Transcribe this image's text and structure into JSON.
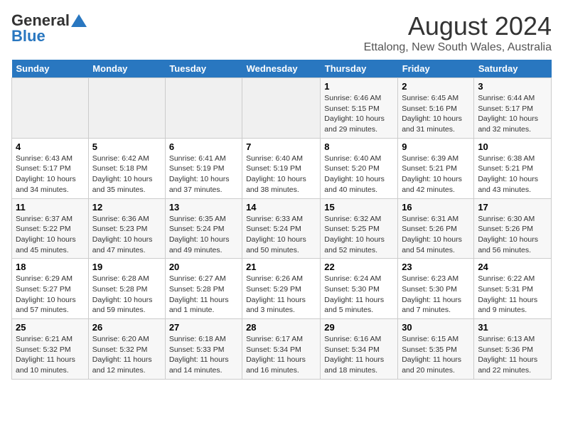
{
  "header": {
    "logo_general": "General",
    "logo_blue": "Blue",
    "month_year": "August 2024",
    "location": "Ettalong, New South Wales, Australia"
  },
  "weekdays": [
    "Sunday",
    "Monday",
    "Tuesday",
    "Wednesday",
    "Thursday",
    "Friday",
    "Saturday"
  ],
  "weeks": [
    [
      {
        "day": "",
        "info": ""
      },
      {
        "day": "",
        "info": ""
      },
      {
        "day": "",
        "info": ""
      },
      {
        "day": "",
        "info": ""
      },
      {
        "day": "1",
        "info": "Sunrise: 6:46 AM\nSunset: 5:15 PM\nDaylight: 10 hours\nand 29 minutes."
      },
      {
        "day": "2",
        "info": "Sunrise: 6:45 AM\nSunset: 5:16 PM\nDaylight: 10 hours\nand 31 minutes."
      },
      {
        "day": "3",
        "info": "Sunrise: 6:44 AM\nSunset: 5:17 PM\nDaylight: 10 hours\nand 32 minutes."
      }
    ],
    [
      {
        "day": "4",
        "info": "Sunrise: 6:43 AM\nSunset: 5:17 PM\nDaylight: 10 hours\nand 34 minutes."
      },
      {
        "day": "5",
        "info": "Sunrise: 6:42 AM\nSunset: 5:18 PM\nDaylight: 10 hours\nand 35 minutes."
      },
      {
        "day": "6",
        "info": "Sunrise: 6:41 AM\nSunset: 5:19 PM\nDaylight: 10 hours\nand 37 minutes."
      },
      {
        "day": "7",
        "info": "Sunrise: 6:40 AM\nSunset: 5:19 PM\nDaylight: 10 hours\nand 38 minutes."
      },
      {
        "day": "8",
        "info": "Sunrise: 6:40 AM\nSunset: 5:20 PM\nDaylight: 10 hours\nand 40 minutes."
      },
      {
        "day": "9",
        "info": "Sunrise: 6:39 AM\nSunset: 5:21 PM\nDaylight: 10 hours\nand 42 minutes."
      },
      {
        "day": "10",
        "info": "Sunrise: 6:38 AM\nSunset: 5:21 PM\nDaylight: 10 hours\nand 43 minutes."
      }
    ],
    [
      {
        "day": "11",
        "info": "Sunrise: 6:37 AM\nSunset: 5:22 PM\nDaylight: 10 hours\nand 45 minutes."
      },
      {
        "day": "12",
        "info": "Sunrise: 6:36 AM\nSunset: 5:23 PM\nDaylight: 10 hours\nand 47 minutes."
      },
      {
        "day": "13",
        "info": "Sunrise: 6:35 AM\nSunset: 5:24 PM\nDaylight: 10 hours\nand 49 minutes."
      },
      {
        "day": "14",
        "info": "Sunrise: 6:33 AM\nSunset: 5:24 PM\nDaylight: 10 hours\nand 50 minutes."
      },
      {
        "day": "15",
        "info": "Sunrise: 6:32 AM\nSunset: 5:25 PM\nDaylight: 10 hours\nand 52 minutes."
      },
      {
        "day": "16",
        "info": "Sunrise: 6:31 AM\nSunset: 5:26 PM\nDaylight: 10 hours\nand 54 minutes."
      },
      {
        "day": "17",
        "info": "Sunrise: 6:30 AM\nSunset: 5:26 PM\nDaylight: 10 hours\nand 56 minutes."
      }
    ],
    [
      {
        "day": "18",
        "info": "Sunrise: 6:29 AM\nSunset: 5:27 PM\nDaylight: 10 hours\nand 57 minutes."
      },
      {
        "day": "19",
        "info": "Sunrise: 6:28 AM\nSunset: 5:28 PM\nDaylight: 10 hours\nand 59 minutes."
      },
      {
        "day": "20",
        "info": "Sunrise: 6:27 AM\nSunset: 5:28 PM\nDaylight: 11 hours\nand 1 minute."
      },
      {
        "day": "21",
        "info": "Sunrise: 6:26 AM\nSunset: 5:29 PM\nDaylight: 11 hours\nand 3 minutes."
      },
      {
        "day": "22",
        "info": "Sunrise: 6:24 AM\nSunset: 5:30 PM\nDaylight: 11 hours\nand 5 minutes."
      },
      {
        "day": "23",
        "info": "Sunrise: 6:23 AM\nSunset: 5:30 PM\nDaylight: 11 hours\nand 7 minutes."
      },
      {
        "day": "24",
        "info": "Sunrise: 6:22 AM\nSunset: 5:31 PM\nDaylight: 11 hours\nand 9 minutes."
      }
    ],
    [
      {
        "day": "25",
        "info": "Sunrise: 6:21 AM\nSunset: 5:32 PM\nDaylight: 11 hours\nand 10 minutes."
      },
      {
        "day": "26",
        "info": "Sunrise: 6:20 AM\nSunset: 5:32 PM\nDaylight: 11 hours\nand 12 minutes."
      },
      {
        "day": "27",
        "info": "Sunrise: 6:18 AM\nSunset: 5:33 PM\nDaylight: 11 hours\nand 14 minutes."
      },
      {
        "day": "28",
        "info": "Sunrise: 6:17 AM\nSunset: 5:34 PM\nDaylight: 11 hours\nand 16 minutes."
      },
      {
        "day": "29",
        "info": "Sunrise: 6:16 AM\nSunset: 5:34 PM\nDaylight: 11 hours\nand 18 minutes."
      },
      {
        "day": "30",
        "info": "Sunrise: 6:15 AM\nSunset: 5:35 PM\nDaylight: 11 hours\nand 20 minutes."
      },
      {
        "day": "31",
        "info": "Sunrise: 6:13 AM\nSunset: 5:36 PM\nDaylight: 11 hours\nand 22 minutes."
      }
    ]
  ]
}
